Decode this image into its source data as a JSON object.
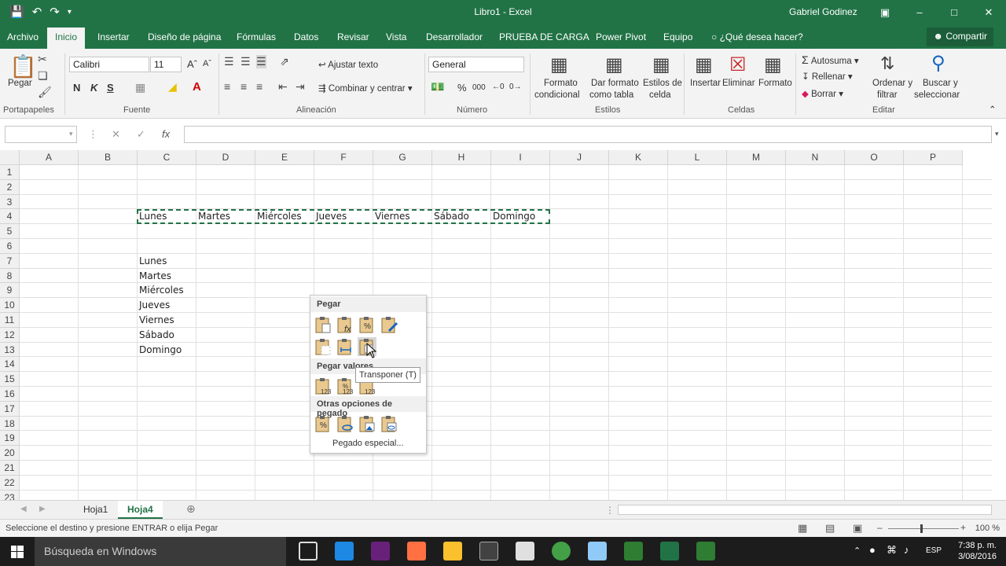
{
  "window": {
    "title": "Libro1 - Excel",
    "user": "Gabriel Godinez"
  },
  "tabs": [
    "Archivo",
    "Inicio",
    "Insertar",
    "Diseño de página",
    "Fórmulas",
    "Datos",
    "Revisar",
    "Vista",
    "Desarrollador",
    "PRUEBA DE CARGA",
    "Power Pivot",
    "Equipo"
  ],
  "active_tab": "Inicio",
  "tell_me": "¿Qué desea hacer?",
  "share": "Compartir",
  "ribbon": {
    "clipboard": {
      "paste": "Pegar",
      "group": "Portapapeles"
    },
    "font": {
      "name": "Calibri",
      "size": "11",
      "bold": "N",
      "italic": "K",
      "underline": "S",
      "group": "Fuente"
    },
    "alignment": {
      "wrap": "Ajustar texto",
      "merge": "Combinar y centrar",
      "group": "Alineación"
    },
    "number": {
      "format": "General",
      "percent": "%",
      "thousands": "000",
      "group": "Número"
    },
    "styles": {
      "conditional_1": "Formato",
      "conditional_2": "condicional",
      "table_1": "Dar formato",
      "table_2": "como tabla",
      "cell_1": "Estilos de",
      "cell_2": "celda",
      "group": "Estilos"
    },
    "cells": {
      "insert": "Insertar",
      "delete": "Eliminar",
      "format": "Formato",
      "group": "Celdas"
    },
    "editing": {
      "autosum": "Autosuma",
      "fill": "Rellenar",
      "clear": "Borrar",
      "sort_1": "Ordenar y",
      "sort_2": "filtrar",
      "find_1": "Buscar y",
      "find_2": "seleccionar",
      "group": "Editar"
    }
  },
  "formula_bar": {
    "name_box": "",
    "fx": "fx",
    "value": ""
  },
  "columns": [
    "A",
    "B",
    "C",
    "D",
    "E",
    "F",
    "G",
    "H",
    "I",
    "J",
    "K",
    "L",
    "M",
    "N",
    "O",
    "P"
  ],
  "rows": [
    "1",
    "2",
    "3",
    "4",
    "5",
    "6",
    "7",
    "8",
    "9",
    "10",
    "11",
    "12",
    "13",
    "14",
    "15",
    "16",
    "17",
    "18",
    "19",
    "20",
    "21",
    "22",
    "23"
  ],
  "row4": [
    "Lunes",
    "Martes",
    "Miércoles",
    "Jueves",
    "Viernes",
    "Sábado",
    "Domingo"
  ],
  "colC": [
    "Lunes",
    "Martes",
    "Miércoles",
    "Jueves",
    "Viernes",
    "Sábado",
    "Domingo"
  ],
  "paste_menu": {
    "paste": "Pegar",
    "paste_values": "Pegar valores",
    "other": "Otras opciones de pegado",
    "special": "Pegado especial...",
    "tooltip": "Transponer (T)"
  },
  "sheets": [
    "Hoja1",
    "Hoja4"
  ],
  "active_sheet": "Hoja4",
  "status": {
    "message": "Seleccione el destino y presione ENTRAR o elija Pegar",
    "zoom": "100 %"
  },
  "taskbar": {
    "search": "Búsqueda en Windows",
    "lang": "ESP",
    "time": "7:38 p. m.",
    "date": "3/08/2016"
  },
  "colors": {
    "excel_green": "#217346",
    "marquee": "#217346"
  }
}
